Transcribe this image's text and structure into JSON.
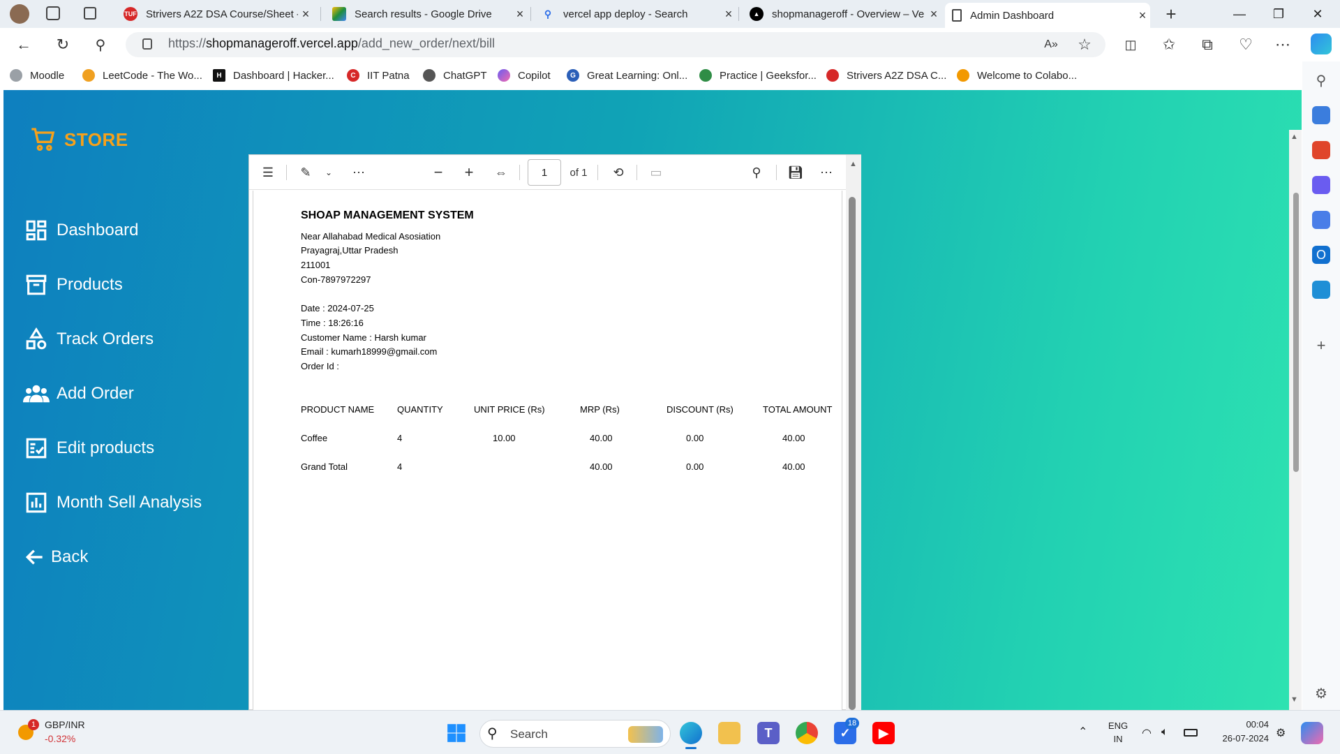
{
  "browser": {
    "tabs": [
      {
        "title": "Strivers A2Z DSA Course/Sheet -",
        "icon": "tuf-icon",
        "color": "#d62828"
      },
      {
        "title": "Search results - Google Drive",
        "icon": "google-drive-icon",
        "color": "#1e8e3e"
      },
      {
        "title": "vercel app deploy - Search",
        "icon": "search-icon",
        "color": "#2b6de8"
      },
      {
        "title": "shopmanageroff - Overview – Ve",
        "icon": "vercel-icon",
        "color": "#000000"
      },
      {
        "title": "Admin Dashboard",
        "icon": "page-icon",
        "color": "#444444"
      }
    ],
    "url_prefix": "https://",
    "url_host": "shopmanageroff.vercel.app",
    "url_path": "/add_new_order/next/bill",
    "bookmarks": [
      {
        "label": "Moodle",
        "color": "#7a7a7a"
      },
      {
        "label": "LeetCode - The Wo...",
        "color": "#f0a020"
      },
      {
        "label": "Dashboard | Hacker...",
        "color": "#111111"
      },
      {
        "label": "IIT Patna",
        "color": "#d62828"
      },
      {
        "label": "ChatGPT",
        "color": "#444444"
      },
      {
        "label": "Copilot",
        "color": "#6a5cf0"
      },
      {
        "label": "Great Learning: Onl...",
        "color": "#2b5fb8"
      },
      {
        "label": "Practice | Geeksfor...",
        "color": "#2f8d46"
      },
      {
        "label": "Strivers A2Z DSA C...",
        "color": "#d62828"
      },
      {
        "label": "Welcome to Colabo...",
        "color": "#f29900"
      }
    ]
  },
  "sidebar": {
    "brand": "STORE",
    "brand_color": "#f7a11a",
    "items": [
      {
        "label": "Dashboard",
        "icon": "dashboard-icon"
      },
      {
        "label": "Products",
        "icon": "archive-box-icon"
      },
      {
        "label": "Track Orders",
        "icon": "shapes-icon"
      },
      {
        "label": "Add Order",
        "icon": "users-group-icon"
      },
      {
        "label": "Edit products",
        "icon": "checklist-icon"
      },
      {
        "label": "Month Sell Analysis",
        "icon": "bar-chart-icon"
      },
      {
        "label": "Back",
        "icon": "arrow-left-icon"
      }
    ]
  },
  "pdf": {
    "page_number": "1",
    "page_count": "of 1",
    "bill": {
      "title": "SHOAP MANAGEMENT SYSTEM",
      "address_lines": [
        "Near Allahabad Medical Asosiation",
        "Prayagraj,Uttar Pradesh",
        "211001",
        "Con-7897972297"
      ],
      "info_lines": [
        "Date : 2024-07-25",
        "Time : 18:26:16",
        "Customer Name : Harsh kumar",
        "Email : kumarh18999@gmail.com",
        "Order Id :"
      ],
      "table_headers": [
        "PRODUCT NAME",
        "QUANTITY",
        "UNIT PRICE (Rs)",
        "MRP (Rs)",
        "DISCOUNT (Rs)",
        "TOTAL AMOUNT"
      ],
      "rows": [
        [
          "Coffee",
          "4",
          "10.00",
          "40.00",
          "0.00",
          "40.00"
        ],
        [
          "Grand Total",
          "4",
          "",
          "40.00",
          "0.00",
          "40.00"
        ]
      ]
    }
  },
  "taskbar": {
    "stock_name": "GBP/INR",
    "stock_change": "-0.32%",
    "stock_badge": "1",
    "search_placeholder": "Search",
    "lang_line1": "ENG",
    "lang_line2": "IN",
    "time": "00:04",
    "date": "26-07-2024",
    "todo_badge": "18"
  }
}
